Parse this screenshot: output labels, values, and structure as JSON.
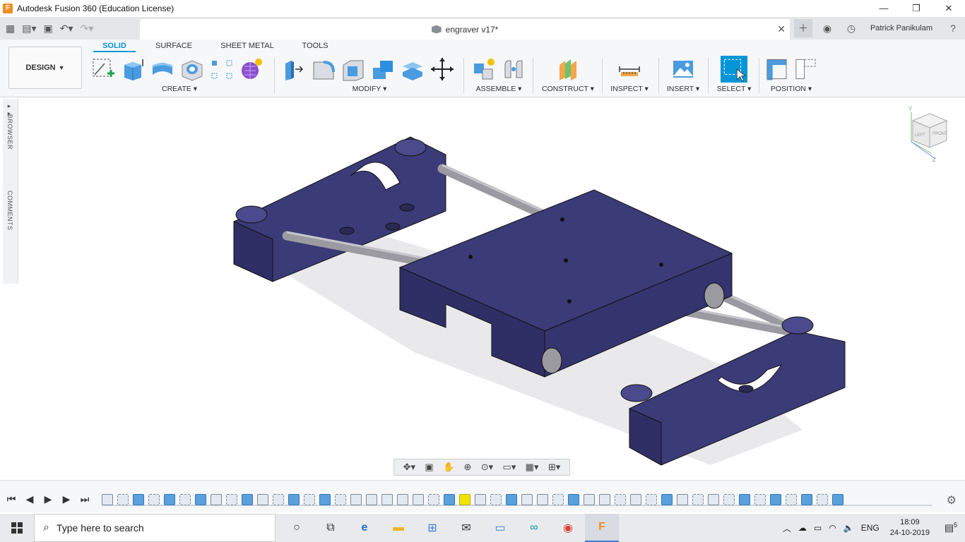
{
  "window": {
    "title": "Autodesk Fusion 360 (Education License)",
    "logo": "F",
    "minimize": "—",
    "maximize": "❐",
    "close": "✕"
  },
  "document_tab": {
    "title": "engraver v17*",
    "close": "✕"
  },
  "user": {
    "name": "Patrick Panikulam"
  },
  "workspace": {
    "label": "DESIGN"
  },
  "ribbon_tabs": [
    "SOLID",
    "SURFACE",
    "SHEET METAL",
    "TOOLS"
  ],
  "groups": {
    "create": "CREATE",
    "modify": "MODIFY",
    "assemble": "ASSEMBLE",
    "construct": "CONSTRUCT",
    "inspect": "INSPECT",
    "insert": "INSERT",
    "select": "SELECT",
    "position": "POSITION"
  },
  "sidebar": {
    "browser": "BROWSER",
    "comments": "COMMENTS"
  },
  "viewcube": {
    "left": "LEFT",
    "front": "FRONT",
    "y": "Y",
    "z": "Z"
  },
  "taskbar": {
    "search_placeholder": "Type here to search",
    "language": "ENG",
    "time": "18:09",
    "date": "24-10-2019",
    "notifications": "5"
  },
  "colors": {
    "accent": "#0696d7",
    "model": "#3b3b78",
    "rod": "#9a9aa0"
  }
}
